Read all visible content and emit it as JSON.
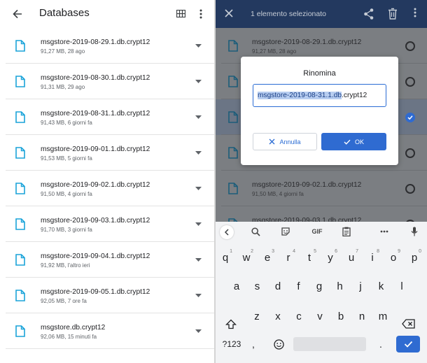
{
  "left": {
    "title": "Databases",
    "files": [
      {
        "name": "msgstore-2019-08-29.1.db.crypt12",
        "meta": "91,27 MB, 28 ago"
      },
      {
        "name": "msgstore-2019-08-30.1.db.crypt12",
        "meta": "91,31 MB, 29 ago"
      },
      {
        "name": "msgstore-2019-08-31.1.db.crypt12",
        "meta": "91,43 MB, 6 giorni fa"
      },
      {
        "name": "msgstore-2019-09-01.1.db.crypt12",
        "meta": "91,53 MB, 5 giorni fa"
      },
      {
        "name": "msgstore-2019-09-02.1.db.crypt12",
        "meta": "91,50 MB, 4 giorni fa"
      },
      {
        "name": "msgstore-2019-09-03.1.db.crypt12",
        "meta": "91,70 MB, 3 giorni fa"
      },
      {
        "name": "msgstore-2019-09-04.1.db.crypt12",
        "meta": "91,92 MB, l'altro ieri"
      },
      {
        "name": "msgstore-2019-09-05.1.db.crypt12",
        "meta": "92,05 MB, 7 ore fa"
      },
      {
        "name": "msgstore.db.crypt12",
        "meta": "92,06 MB, 15 minuti fa"
      }
    ]
  },
  "right": {
    "selection_title": "1 elemento selezionato",
    "files": [
      {
        "name": "msgstore-2019-08-29.1.db.crypt12",
        "meta": "91,27 MB, 28 ago"
      },
      {
        "name": "",
        "meta": ""
      },
      {
        "name": "",
        "meta": ""
      },
      {
        "name": "",
        "meta": ""
      },
      {
        "name": "msgstore-2019-09-02.1.db.crypt12",
        "meta": "91,50 MB, 4 giorni fa"
      },
      {
        "name": "msgstore-2019-09-03.1.db.crypt12",
        "meta": ""
      }
    ]
  },
  "dialog": {
    "title": "Rinomina",
    "value_selected": "msgstore-2019-08-31.1.db",
    "value_rest": ".crypt12",
    "cancel_label": "Annulla",
    "ok_label": "OK"
  },
  "keyboard": {
    "toolbar_gif": "GIF",
    "row1": [
      "q",
      "w",
      "e",
      "r",
      "t",
      "y",
      "u",
      "i",
      "o",
      "p"
    ],
    "row1_sup": [
      "1",
      "2",
      "3",
      "4",
      "5",
      "6",
      "7",
      "8",
      "9",
      "0"
    ],
    "row2": [
      "a",
      "s",
      "d",
      "f",
      "g",
      "h",
      "j",
      "k",
      "l"
    ],
    "row3": [
      "z",
      "x",
      "c",
      "v",
      "b",
      "n",
      "m"
    ],
    "sym_label": "?123",
    "comma": ",",
    "period": "."
  },
  "colors": {
    "accent": "#2f6bd1",
    "header_dark": "#23395f",
    "file_icon": "#1aa3d9"
  }
}
